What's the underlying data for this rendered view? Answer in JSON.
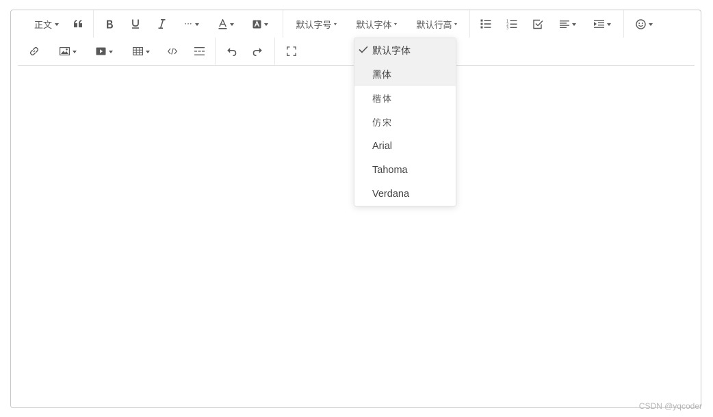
{
  "toolbar": {
    "heading_label": "正文",
    "font_size_label": "默认字号",
    "font_family_label": "默认字体",
    "line_height_label": "默认行高",
    "more_label": "···"
  },
  "font_dropdown": {
    "selected": "默认字体",
    "items": [
      {
        "label": "默认字体",
        "selected": true
      },
      {
        "label": "黑体"
      },
      {
        "label": "楷体"
      },
      {
        "label": "仿宋"
      },
      {
        "label": "Arial"
      },
      {
        "label": "Tahoma"
      },
      {
        "label": "Verdana"
      }
    ]
  },
  "watermark": "CSDN @yqcoder",
  "icons": [
    "quote-icon",
    "bold-icon",
    "underline-icon",
    "italic-icon",
    "more-icon",
    "font-color-icon",
    "bg-color-icon",
    "bulleted-list-icon",
    "numbered-list-icon",
    "todo-icon",
    "justify-icon",
    "indent-icon",
    "emoji-icon",
    "link-icon",
    "image-icon",
    "video-icon",
    "table-icon",
    "code-block-icon",
    "divider-icon",
    "undo-icon",
    "redo-icon",
    "fullscreen-icon",
    "check-icon"
  ],
  "colors": {
    "border": "#c8c8c8",
    "icon": "#595959",
    "highlight": "#f1f1f1"
  }
}
